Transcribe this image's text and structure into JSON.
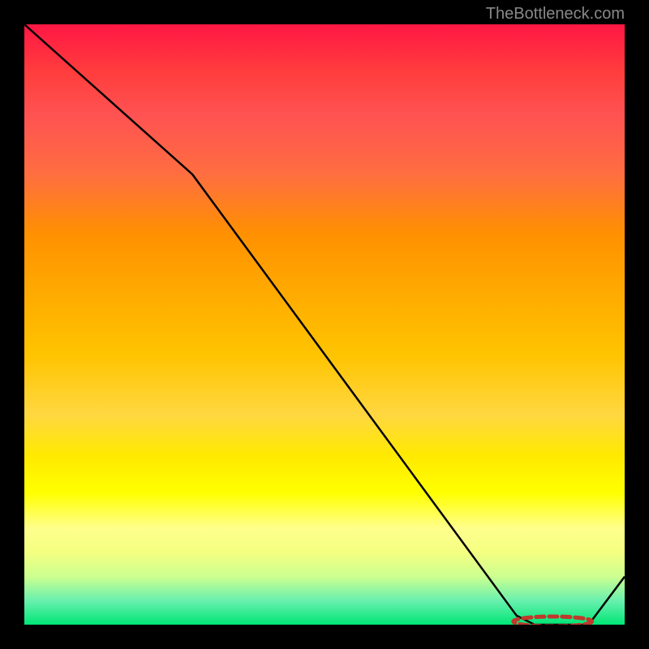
{
  "attribution": "TheBottleneck.com",
  "chart_data": {
    "type": "line",
    "title": "",
    "xlabel": "",
    "ylabel": "",
    "xlim": [
      0,
      100
    ],
    "ylim": [
      0,
      100
    ],
    "series": [
      {
        "name": "curve",
        "x": [
          0,
          28,
          82,
          85,
          94,
          100
        ],
        "values": [
          100,
          75,
          1.5,
          0,
          0,
          8
        ]
      }
    ],
    "markers": {
      "name": "cluster",
      "x_range": [
        82,
        94
      ],
      "y": 0,
      "style": "dashed-red-oval"
    },
    "grid": false,
    "legend": false
  }
}
